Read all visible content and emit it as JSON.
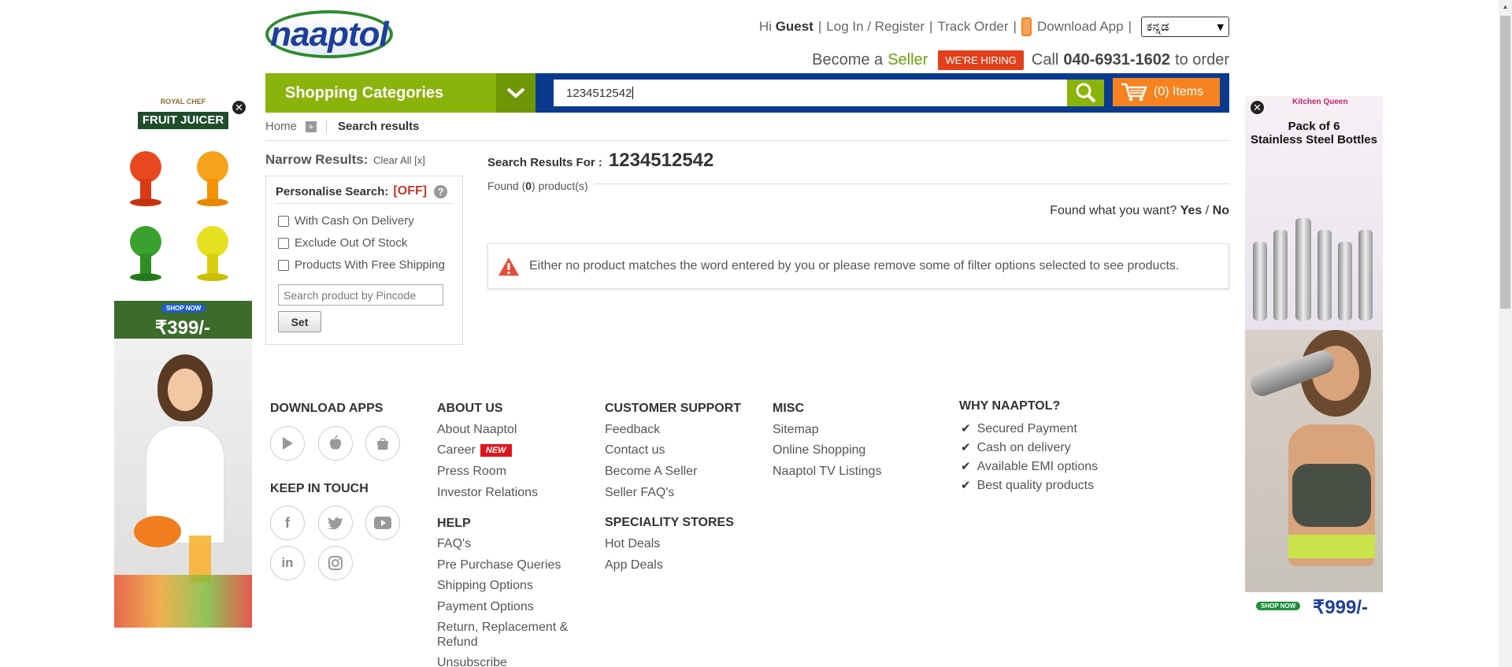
{
  "header": {
    "logo_text": "naaptol",
    "greeting_prefix": "Hi",
    "greeting_user": "Guest",
    "login": "Log In / Register",
    "track_order": "Track Order",
    "download_app": "Download App",
    "language": "ಕನ್ನಡ",
    "become": "Become a",
    "seller": "Seller",
    "hiring": "WE'RE HIRING",
    "call": "Call",
    "phone": "040-6931-1602",
    "to_order": "to order"
  },
  "nav": {
    "categories": "Shopping Categories",
    "search_value": "1234512542",
    "cart": "(0) Items"
  },
  "breadcrumb": {
    "home": "Home",
    "current": "Search results"
  },
  "filters": {
    "narrow": "Narrow Results:",
    "clear_all": "Clear All [x]",
    "personalise": "Personalise Search:",
    "personalise_state": "[OFF]",
    "options": [
      "With Cash On Delivery",
      "Exclude Out Of Stock",
      "Products With Free Shipping"
    ],
    "pincode_placeholder": "Search product by Pincode",
    "set": "Set"
  },
  "results": {
    "label": "Search Results For :",
    "query": "1234512542",
    "found_prefix": "Found (",
    "found_count": "0",
    "found_suffix": ") product(s)",
    "feedback_q": "Found what you want?",
    "yes": "Yes",
    "slash": "/",
    "no": "No",
    "message": "Either no product matches the word entered by you or please remove some of filter options selected to see products."
  },
  "footer": {
    "download_apps": "DOWNLOAD APPS",
    "keep_in_touch": "KEEP IN TOUCH",
    "about_us": "ABOUT US",
    "about_links": [
      "About Naaptol",
      "Career",
      "Press Room",
      "Investor Relations"
    ],
    "new_badge": "NEW",
    "help": "HELP",
    "help_links": [
      "FAQ's",
      "Pre Purchase Queries",
      "Shipping Options",
      "Payment Options",
      "Return, Replacement &",
      "Refund",
      "Unsubscribe"
    ],
    "customer_support": "CUSTOMER SUPPORT",
    "support_links": [
      "Feedback",
      "Contact us",
      "Become A Seller",
      "Seller FAQ's"
    ],
    "speciality_stores": "SPECIALITY STORES",
    "speciality_links": [
      "Hot Deals",
      "App Deals"
    ],
    "misc": "MISC",
    "misc_links": [
      "Sitemap",
      "Online Shopping",
      "Naaptol TV Listings"
    ],
    "why": "WHY NAAPTOL?",
    "why_points": [
      "Secured Payment",
      "Cash on delivery",
      "Available EMI options",
      "Best quality products"
    ]
  },
  "ads": {
    "left_brand": "ROYAL CHEF",
    "left_title": "FRUIT JUICER",
    "left_shop": "SHOP NOW",
    "left_price": "₹399/-",
    "right_brand": "Kitchen Queen",
    "right_title1": "Pack of 6",
    "right_title2": "Stainless Steel Bottles",
    "right_shop": "SHOP NOW",
    "right_price": "₹999/-"
  },
  "colors": {
    "green": "#8ab40c",
    "blue": "#0a3a8e",
    "orange": "#f6831f",
    "red": "#e2411b"
  }
}
